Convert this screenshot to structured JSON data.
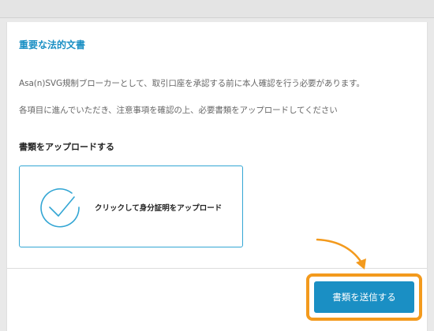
{
  "document": {
    "title": "重要な法的文書",
    "paragraphs": [
      "Asa(n)SVG規制ブローカーとして、取引口座を承認する前に本人確認を行う必要があります。",
      "各項目に進んでいただき、注意事項を確認の上、必要書類をアップロードしてください"
    ]
  },
  "upload": {
    "section_title": "書類をアップロードする",
    "label": "クリックして身分証明をアップロード",
    "icon": "check-circle-icon"
  },
  "footer": {
    "submit_label": "書類を送信する"
  },
  "colors": {
    "accent": "#1a8fc4",
    "highlight": "#f39a1d"
  }
}
